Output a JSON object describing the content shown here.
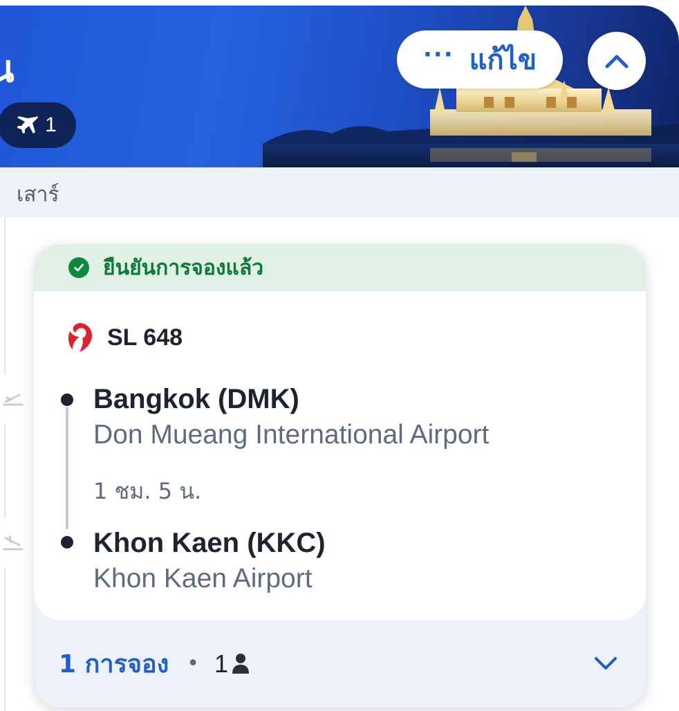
{
  "header": {
    "title": "ก่น",
    "flight_chip_count": "1",
    "edit_dots": "···",
    "edit_label": "แก้ไข"
  },
  "day_strip": {
    "label": "เสาร์"
  },
  "card": {
    "status": "ยืนยันการจองแล้ว",
    "flight_number": "SL 648",
    "departure": {
      "city": "Bangkok (DMK)",
      "airport": "Don Mueang International Airport"
    },
    "duration": "1 ชม. 5 น.",
    "arrival": {
      "city": "Khon Kaen (KKC)",
      "airport": "Khon Kaen Airport"
    },
    "footer": {
      "booking_count": "1 การจอง",
      "separator": "•",
      "passenger_count": "1"
    }
  },
  "colors": {
    "brand_blue": "#1f5fcc",
    "confirmed_green": "#0b8a3e",
    "dark_chip": "#0f2356",
    "airline_red": "#e0202a"
  },
  "icons": {
    "check": "check-circle-icon",
    "plane": "plane-icon",
    "airline": "airline-logo-icon",
    "person": "person-icon",
    "expand": "chevron-down-icon",
    "collapse": "chevron-up-icon"
  }
}
